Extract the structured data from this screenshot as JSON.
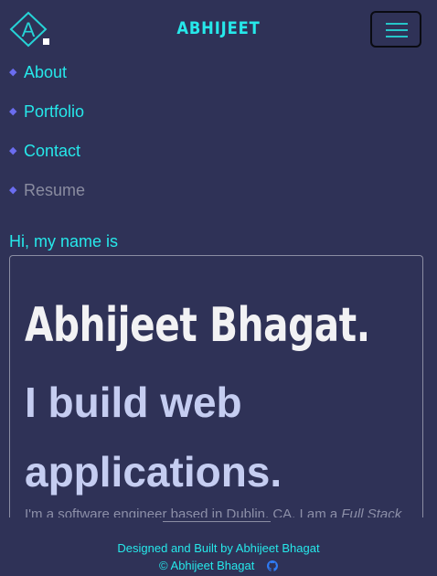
{
  "header": {
    "logo_letter": "A",
    "brand": "ABHIJEET",
    "menu_icon": "hamburger-icon"
  },
  "nav": {
    "items": [
      {
        "label": "About"
      },
      {
        "label": "Portfolio"
      },
      {
        "label": "Contact"
      },
      {
        "label": "Resume"
      }
    ],
    "bullet_icon": "diamond-icon"
  },
  "hero": {
    "greeting": "Hi, my name is",
    "name": "Abhijeet Bhagat.",
    "tagline": "I build web applications.",
    "description_prefix": "I'm a software engineer based in Dublin, CA. I am a ",
    "description_emphasis": "Full Stack"
  },
  "footer": {
    "built_by": "Designed and Built by Abhijeet Bhagat",
    "copyright": "© Abhijeet Bhagat",
    "github_icon": "github-icon"
  },
  "colors": {
    "background": "#2f3257",
    "accent": "#26e8ea",
    "bullet": "#6b6df0",
    "muted": "#8a8ca0",
    "heading": "#f2f2f4",
    "tagline": "#c5cdf1"
  }
}
